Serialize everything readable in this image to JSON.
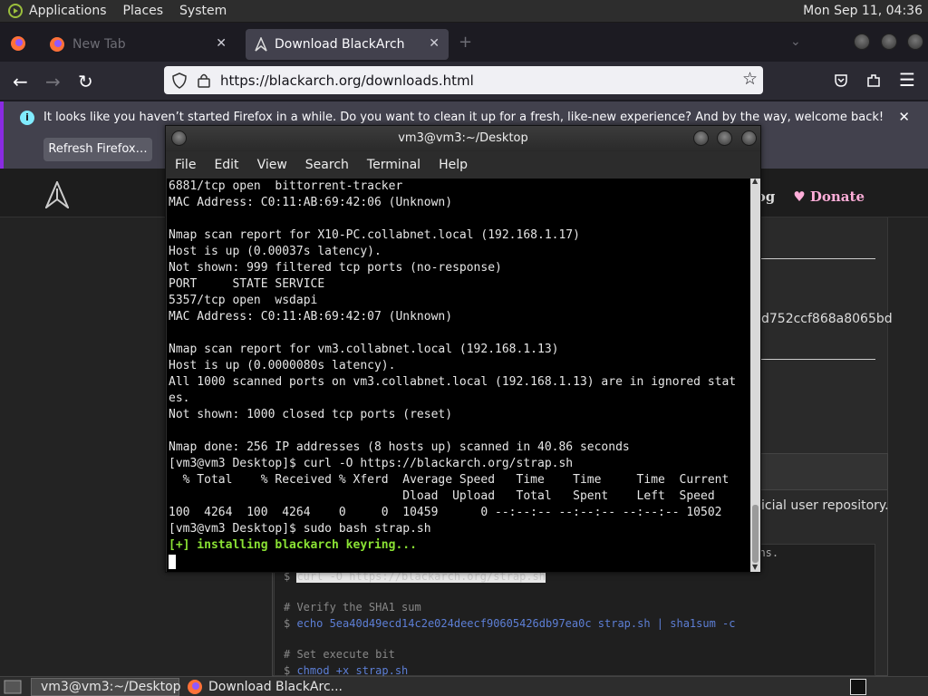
{
  "panel": {
    "menus": [
      "Applications",
      "Places",
      "System"
    ],
    "clock": "Mon Sep 11, 04:36"
  },
  "firefox": {
    "tabs": [
      {
        "label": "New Tab",
        "active": false
      },
      {
        "label": "Download BlackArch",
        "active": true
      }
    ],
    "url": "https://blackarch.org/downloads.html",
    "notification": {
      "message": "It looks like you haven’t started Firefox in a while. Do you want to clean it up for a fresh, like-new experience? And by the way, welcome back!",
      "button": "Refresh Firefox…"
    }
  },
  "site": {
    "nav_partial": "og",
    "donate": "Donate",
    "sha_partial": "d752ccf868a8065bd",
    "repo_partial": "icial user repository.",
    "code_lines": [
      {
        "comment": "",
        "prefix": "$ ",
        "text": "curl -O https://blackarch.org/strap.sh",
        "suffix_partial": "ions."
      },
      {
        "comment": "# Verify the SHA1 sum"
      },
      {
        "prefix": "$ ",
        "cmd": "echo 5ea40d49ecd14c2e024deecf90605426db97ea0c strap.sh | sha1sum -c"
      },
      {
        "comment": "# Set execute bit"
      },
      {
        "prefix": "$ ",
        "cmd": "chmod +x strap.sh"
      }
    ]
  },
  "terminal": {
    "title": "vm3@vm3:~/Desktop",
    "menu": [
      "File",
      "Edit",
      "View",
      "Search",
      "Terminal",
      "Help"
    ],
    "lines": [
      "6881/tcp open  bittorrent-tracker",
      "MAC Address: C0:11:AB:69:42:06 (Unknown)",
      "",
      "Nmap scan report for X10-PC.collabnet.local (192.168.1.17)",
      "Host is up (0.00037s latency).",
      "Not shown: 999 filtered tcp ports (no-response)",
      "PORT     STATE SERVICE",
      "5357/tcp open  wsdapi",
      "MAC Address: C0:11:AB:69:42:07 (Unknown)",
      "",
      "Nmap scan report for vm3.collabnet.local (192.168.1.13)",
      "Host is up (0.0000080s latency).",
      "All 1000 scanned ports on vm3.collabnet.local (192.168.1.13) are in ignored stat",
      "es.",
      "Not shown: 1000 closed tcp ports (reset)",
      "",
      "Nmap done: 256 IP addresses (8 hosts up) scanned in 40.86 seconds",
      "[vm3@vm3 Desktop]$ curl -O https://blackarch.org/strap.sh",
      "  % Total    % Received % Xferd  Average Speed   Time    Time     Time  Current",
      "                                 Dload  Upload   Total   Spent    Left  Speed",
      "100  4264  100  4264    0     0  10459      0 --:--:-- --:--:-- --:--:-- 10502",
      "[vm3@vm3 Desktop]$ sudo bash strap.sh"
    ],
    "green_line": "[+] installing blackarch keyring..."
  },
  "taskbar": {
    "items": [
      "vm3@vm3:~/Desktop",
      "Download BlackArc..."
    ]
  }
}
